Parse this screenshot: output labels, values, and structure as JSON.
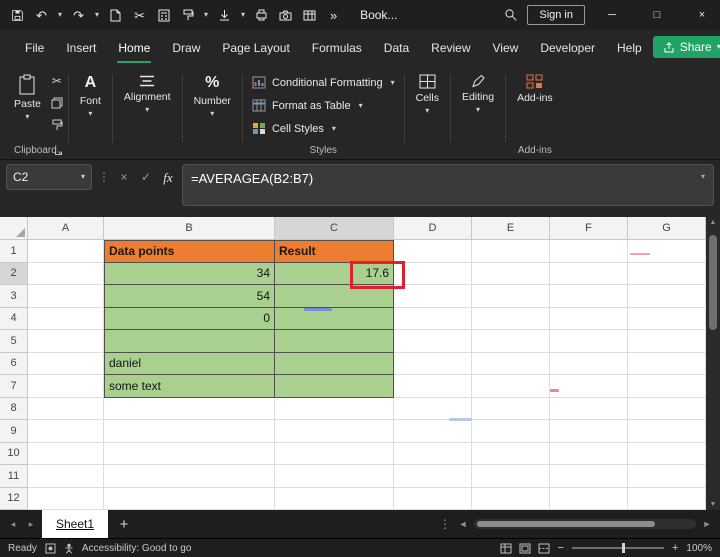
{
  "titlebar": {
    "workbook_name": "Book...",
    "sign_in_label": "Sign in"
  },
  "menubar": {
    "items": [
      "File",
      "Insert",
      "Home",
      "Draw",
      "Page Layout",
      "Formulas",
      "Data",
      "Review",
      "View",
      "Developer",
      "Help"
    ],
    "active_item": "Home",
    "share_label": "Share"
  },
  "ribbon": {
    "paste_label": "Paste",
    "font_label": "Font",
    "font_icon_letter": "A",
    "alignment_label": "Alignment",
    "number_label": "Number",
    "number_icon": "%",
    "conditional_formatting_label": "Conditional Formatting",
    "format_as_table_label": "Format as Table",
    "cell_styles_label": "Cell Styles",
    "cells_label": "Cells",
    "editing_label": "Editing",
    "addins_label": "Add-ins",
    "group_labels": {
      "clipboard": "Clipboard",
      "styles": "Styles",
      "addins": "Add-ins"
    }
  },
  "formula_bar": {
    "name_box_value": "C2",
    "formula": "=AVERAGEA(B2:B7)"
  },
  "grid": {
    "columns": [
      "A",
      "B",
      "C",
      "D",
      "E",
      "F",
      "G"
    ],
    "rows": [
      "1",
      "2",
      "3",
      "4",
      "5",
      "6",
      "7",
      "8",
      "9",
      "10",
      "11",
      "12"
    ],
    "cells": {
      "B1": "Data points",
      "C1": "Result",
      "B2": "34",
      "B3": "54",
      "B4": "0",
      "B6": "daniel",
      "B7": "some text",
      "C2": "17.6"
    },
    "selected_cell": "C2"
  },
  "sheet_tabs": {
    "active_tab": "Sheet1",
    "add_sheet_label": "+"
  },
  "status_bar": {
    "mode": "Ready",
    "accessibility": "Accessibility: Good to go",
    "zoom_level": "100%"
  },
  "glyphs": {
    "caret_down": "▾",
    "undo": "↶",
    "redo": "↷",
    "scissors": "✂",
    "overflow": "»",
    "minimize": "─",
    "maximize": "□",
    "close": "×",
    "ellipsis_v": "⋮",
    "cancel": "×",
    "enter": "✓",
    "fx": "fx",
    "nav_left": "◂",
    "nav_right": "▸",
    "scroll_left": "◄",
    "scroll_right": "►",
    "scroll_up": "▲",
    "scroll_down": "▼",
    "zoom_out": "−",
    "zoom_in": "+"
  },
  "colors": {
    "header_fill": "#ED7D31",
    "data_fill": "#A9D08E",
    "highlight_border": "#E0202A",
    "accent_green": "#21A366"
  }
}
